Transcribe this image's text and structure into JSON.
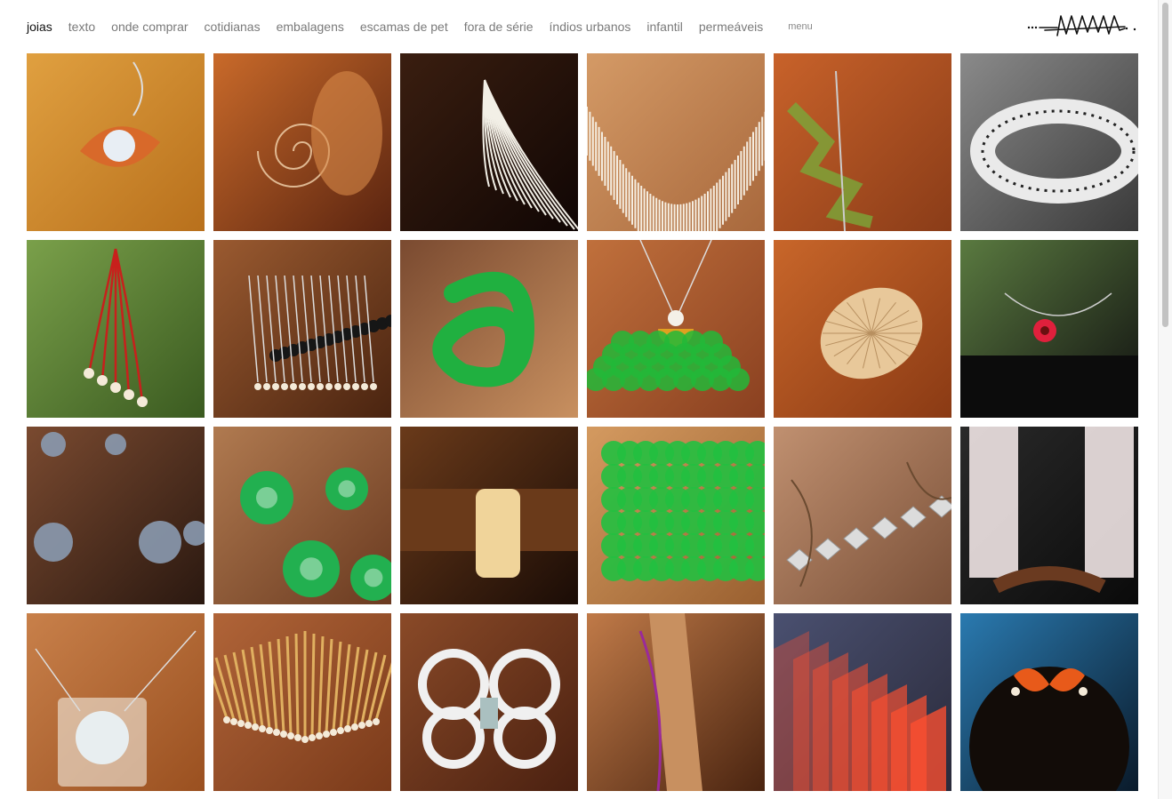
{
  "nav": {
    "items": [
      {
        "label": "joias",
        "active": true
      },
      {
        "label": "texto",
        "active": false
      },
      {
        "label": "onde comprar",
        "active": false
      },
      {
        "label": "cotidianas",
        "active": false
      },
      {
        "label": "embalagens",
        "active": false
      },
      {
        "label": "escamas de pet",
        "active": false
      },
      {
        "label": "fora de série",
        "active": false
      },
      {
        "label": "índios urbanos",
        "active": false
      },
      {
        "label": "infantil",
        "active": false
      },
      {
        "label": "permeáveis",
        "active": false
      }
    ],
    "menu_label": "menu"
  },
  "logo": {
    "icon": "handwritten-signature-logo"
  },
  "gallery": {
    "items": [
      {
        "name": "earring-orange-eye",
        "bg": [
          "#e0a040",
          "#b8701c"
        ],
        "accent": "#d8692a",
        "shape": "eye"
      },
      {
        "name": "hand-spiral-pendant",
        "bg": [
          "#c96a2a",
          "#5a2410"
        ],
        "accent": "#f4d6b0",
        "shape": "spiral"
      },
      {
        "name": "white-fiber-tassel",
        "bg": [
          "#3a1e10",
          "#100604"
        ],
        "accent": "#f2efe6",
        "shape": "tassel"
      },
      {
        "name": "white-fringe-collar",
        "bg": [
          "#d49a66",
          "#a8683c"
        ],
        "accent": "#f5ede0",
        "shape": "collar"
      },
      {
        "name": "green-geometric-necklace",
        "bg": [
          "#c8622a",
          "#8a3c18"
        ],
        "accent": "#7aa83a",
        "shape": "zigzag"
      },
      {
        "name": "white-ring-bracelet",
        "bg": [
          "#8a8a8a",
          "#3a3a3a"
        ],
        "accent": "#eaeaea",
        "shape": "bangle"
      },
      {
        "name": "red-wire-earring",
        "bg": [
          "#7aa04a",
          "#3a5a20"
        ],
        "accent": "#c8201c",
        "shape": "wires"
      },
      {
        "name": "black-pearl-fan-necklace",
        "bg": [
          "#9a5a30",
          "#4a2410"
        ],
        "accent": "#161616",
        "shape": "fan"
      },
      {
        "name": "green-knot-ring",
        "bg": [
          "#7a4a30",
          "#c89060"
        ],
        "accent": "#20b040",
        "shape": "knot"
      },
      {
        "name": "green-scale-pendant",
        "bg": [
          "#c0703c",
          "#8a4020"
        ],
        "accent": "#22b838",
        "shape": "scales"
      },
      {
        "name": "gold-shell-brooch",
        "bg": [
          "#c8662a",
          "#8a3a14"
        ],
        "accent": "#e8c89a",
        "shape": "shell"
      },
      {
        "name": "red-ring-choker",
        "bg": [
          "#5a7a40",
          "#101010"
        ],
        "accent": "#e0203c",
        "shape": "choker"
      },
      {
        "name": "glass-bead-necklace",
        "bg": [
          "#7a4a30",
          "#2a1810"
        ],
        "accent": "#8a9ab0",
        "shape": "beads"
      },
      {
        "name": "green-rosette-necklace",
        "bg": [
          "#b07a50",
          "#6a3a20"
        ],
        "accent": "#22b050",
        "shape": "rosettes"
      },
      {
        "name": "cream-cuff-bracelet",
        "bg": [
          "#6a3a1a",
          "#1a0c06"
        ],
        "accent": "#f0d49a",
        "shape": "cuff"
      },
      {
        "name": "green-scale-cuff",
        "bg": [
          "#d49a60",
          "#9a6030"
        ],
        "accent": "#22c040",
        "shape": "bigcuff"
      },
      {
        "name": "crystal-cord-necklace",
        "bg": [
          "#c09070",
          "#7a5038"
        ],
        "accent": "#dcdcdc",
        "shape": "crystals"
      },
      {
        "name": "white-mesh-arm-cuffs",
        "bg": [
          "#2a2a2a",
          "#0a0a0a"
        ],
        "accent": "#f0e4e4",
        "shape": "mesh"
      },
      {
        "name": "mirror-square-pendant",
        "bg": [
          "#c8804a",
          "#9a5020"
        ],
        "accent": "#e8eef0",
        "shape": "mirror"
      },
      {
        "name": "gold-stick-pearl-collar",
        "bg": [
          "#b06438",
          "#7a3a1a"
        ],
        "accent": "#e0b060",
        "shape": "sticks"
      },
      {
        "name": "white-mesh-loop-necklace",
        "bg": [
          "#8a4a28",
          "#4a2010"
        ],
        "accent": "#f0f0f0",
        "shape": "loops"
      },
      {
        "name": "hair-purple-stick",
        "bg": [
          "#c07a48",
          "#4a2410"
        ],
        "accent": "#9a2a9a",
        "shape": "hair"
      },
      {
        "name": "neon-layered-sheets",
        "bg": [
          "#4a5070",
          "#2a2a3a"
        ],
        "accent": "#ff5030",
        "shape": "layers"
      },
      {
        "name": "orange-bow-hairpin",
        "bg": [
          "#2a7ab0",
          "#0a1a2a"
        ],
        "accent": "#e85a1a",
        "shape": "bow"
      }
    ]
  },
  "scrollbar": {
    "position_fraction": 0.0
  }
}
